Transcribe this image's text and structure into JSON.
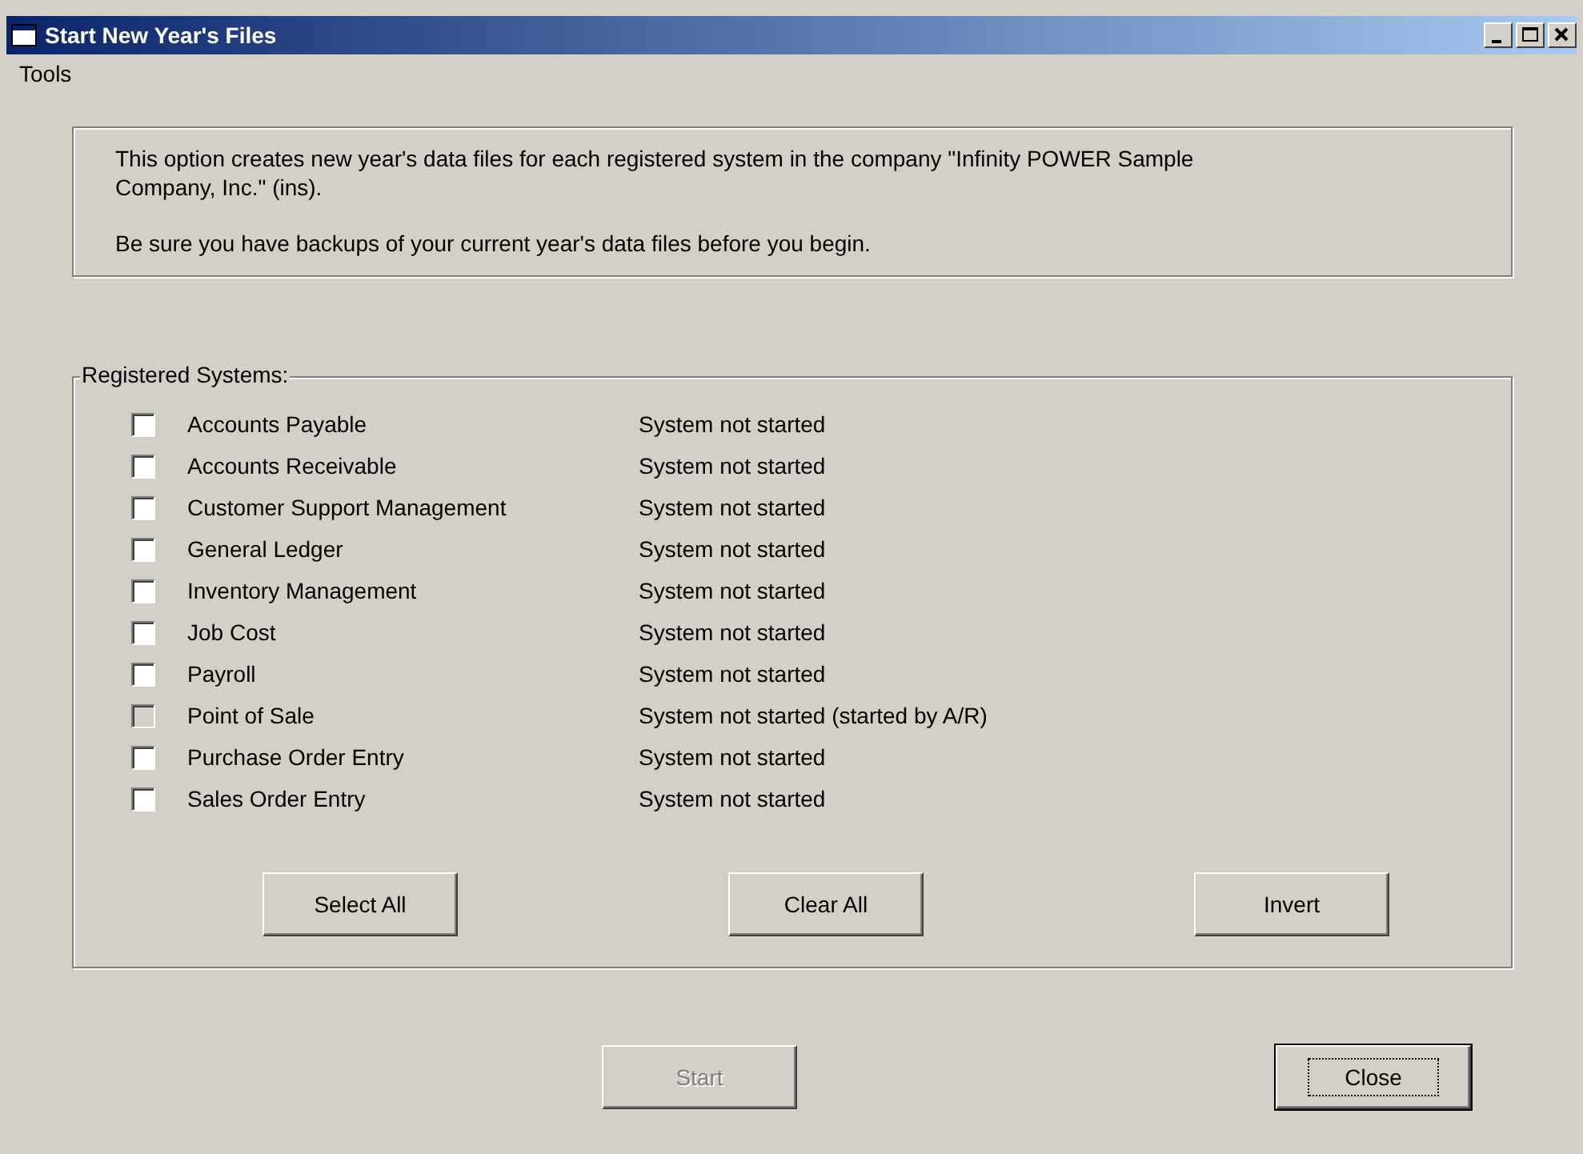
{
  "window": {
    "title": "Start New Year's Files"
  },
  "menu": [
    "Tools"
  ],
  "info": [
    "This option creates new year's data files for each registered system in the company \"Infinity POWER Sample Company, Inc.\" (ins).",
    "Be sure you have backups of your current year's data files before you begin."
  ],
  "systems": {
    "label": "Registered Systems:",
    "items": [
      {
        "name": "Accounts Payable",
        "status": "System not started",
        "checked": false,
        "disabled": false
      },
      {
        "name": "Accounts Receivable",
        "status": "System not started",
        "checked": false,
        "disabled": false
      },
      {
        "name": "Customer Support Management",
        "status": "System not started",
        "checked": false,
        "disabled": false
      },
      {
        "name": "General Ledger",
        "status": "System not started",
        "checked": false,
        "disabled": false
      },
      {
        "name": "Inventory Management",
        "status": "System not started",
        "checked": false,
        "disabled": false
      },
      {
        "name": "Job Cost",
        "status": "System not started",
        "checked": false,
        "disabled": false
      },
      {
        "name": "Payroll",
        "status": "System not started",
        "checked": false,
        "disabled": false
      },
      {
        "name": "Point of Sale",
        "status": "System not started (started by A/R)",
        "checked": false,
        "disabled": true
      },
      {
        "name": "Purchase Order Entry",
        "status": "System not started",
        "checked": false,
        "disabled": false
      },
      {
        "name": "Sales Order Entry",
        "status": "System not started",
        "checked": false,
        "disabled": false
      }
    ],
    "buttons": [
      "Select All",
      "Clear All",
      "Invert"
    ]
  },
  "footer_buttons": [
    {
      "label": "Start",
      "disabled": true,
      "default": false
    },
    {
      "label": "Close",
      "disabled": false,
      "default": true
    }
  ]
}
